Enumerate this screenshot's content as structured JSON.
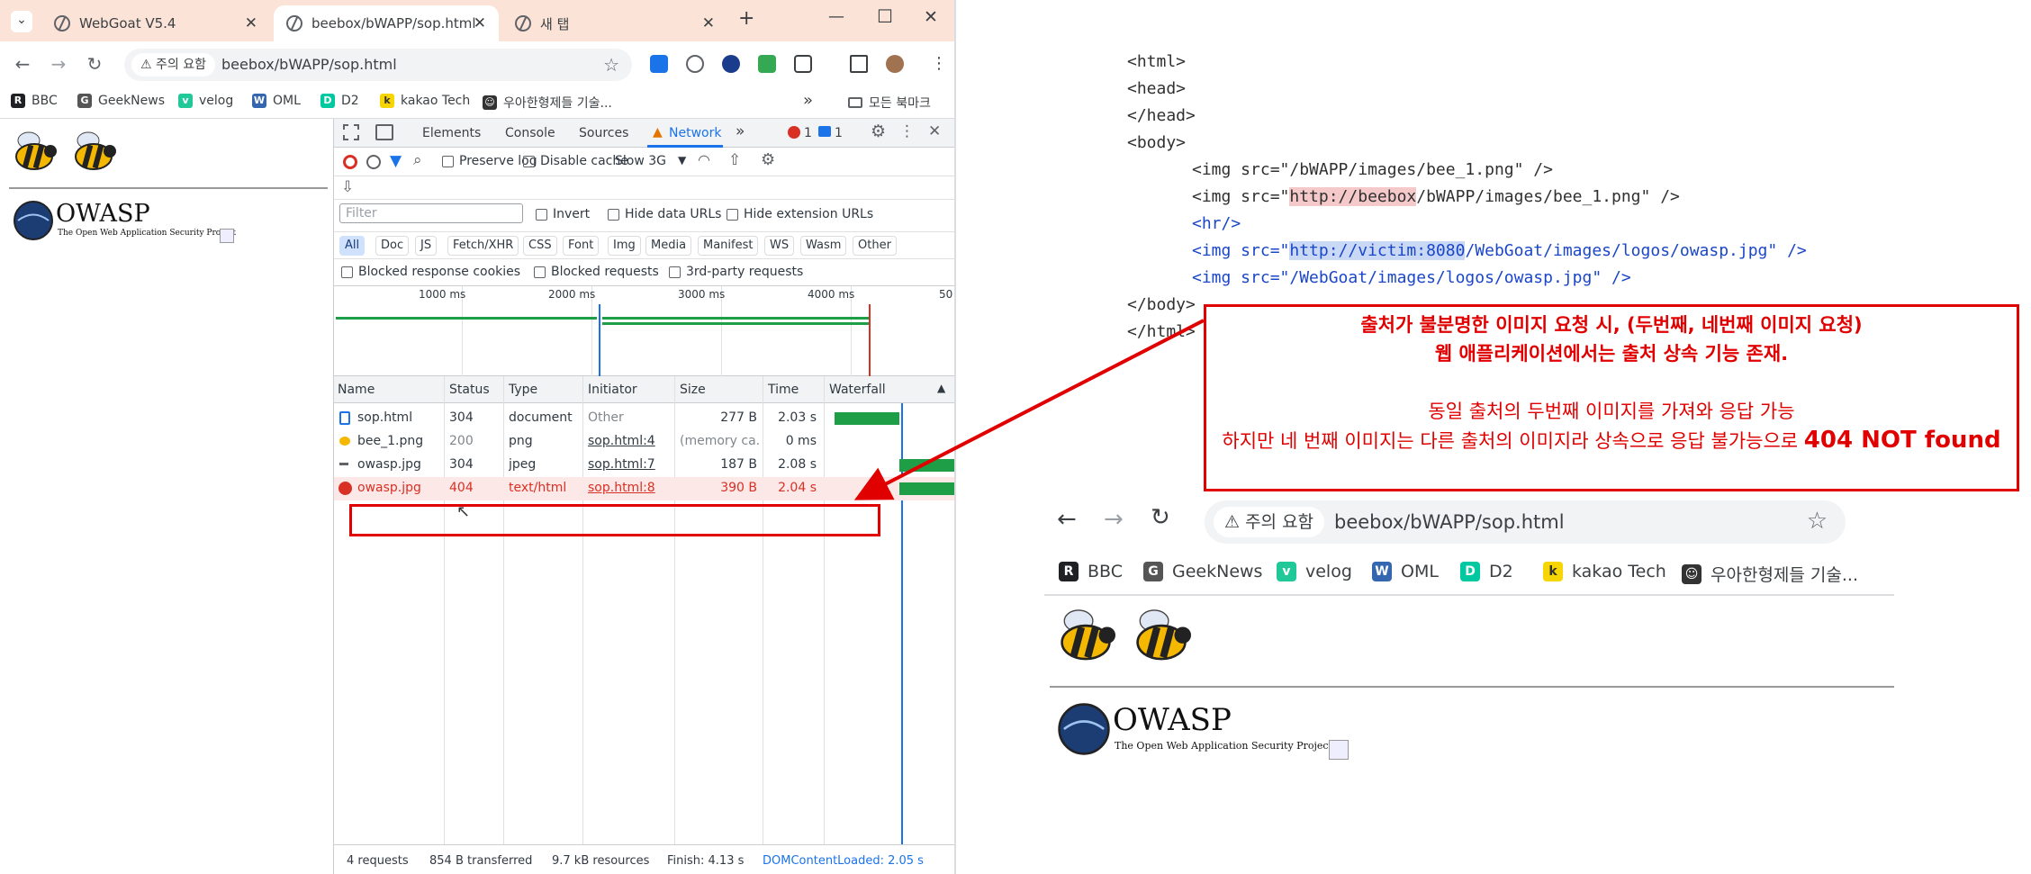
{
  "tabs": [
    {
      "title": "WebGoat V5.4",
      "close": "✕"
    },
    {
      "title": "beebox/bWAPP/sop.html",
      "close": "✕"
    },
    {
      "title": "새 탭",
      "close": "✕"
    }
  ],
  "tabbar": {
    "dropdown": "⌄",
    "new_tab": "+",
    "minimize": "—",
    "maximize": "☐",
    "close": "✕"
  },
  "omnibox": {
    "security": "⚠ 주의 요함",
    "url": "beebox/bWAPP/sop.html"
  },
  "bookmarks": {
    "items": [
      {
        "label": "BBC",
        "icon": "R",
        "color": "#202124"
      },
      {
        "label": "GeekNews",
        "icon": "G",
        "color": "#555555"
      },
      {
        "label": "velog",
        "icon": "v",
        "color": "#20c997"
      },
      {
        "label": "OML",
        "icon": "W",
        "color": "#3467b0"
      },
      {
        "label": "D2",
        "icon": "D",
        "color": "#00c8a0"
      },
      {
        "label": "kakao Tech",
        "icon": "k",
        "color": "#f7d500"
      },
      {
        "label": "우아한형제들 기술...",
        "icon": "☺",
        "color": "#333333"
      }
    ],
    "overflow": "»",
    "all": "모든 북마크"
  },
  "page": {
    "owasp_title": "OWASP",
    "owasp_sub": "The Open Web Application Security Project"
  },
  "devtools": {
    "tabs": [
      "Elements",
      "Console",
      "Sources",
      "Network"
    ],
    "more": "»",
    "errors": "1",
    "messages": "1",
    "preserve_log": "Preserve log",
    "disable_cache": "Disable cache",
    "throttle": "Slow 3G",
    "filter_placeholder": "Filter",
    "invert": "Invert",
    "hide_data_urls": "Hide data URLs",
    "hide_extension_urls": "Hide extension URLs",
    "type_filters": [
      "All",
      "Doc",
      "JS",
      "Fetch/XHR",
      "CSS",
      "Font",
      "Img",
      "Media",
      "Manifest",
      "WS",
      "Wasm",
      "Other"
    ],
    "blocked_cookies": "Blocked response cookies",
    "blocked_requests": "Blocked requests",
    "third_party": "3rd-party requests",
    "timeline_ticks": [
      "1000 ms",
      "2000 ms",
      "3000 ms",
      "4000 ms",
      "50"
    ],
    "columns": [
      "Name",
      "Status",
      "Type",
      "Initiator",
      "Size",
      "Time",
      "Waterfall"
    ],
    "rows": [
      {
        "name": "sop.html",
        "status": "304",
        "type": "document",
        "initiator": "Other",
        "size": "277 B",
        "time": "2.03 s"
      },
      {
        "name": "bee_1.png",
        "status": "200",
        "type": "png",
        "initiator": "sop.html:4",
        "size": "(memory ca...",
        "time": "0 ms"
      },
      {
        "name": "owasp.jpg",
        "status": "304",
        "type": "jpeg",
        "initiator": "sop.html:7",
        "size": "187 B",
        "time": "2.08 s"
      },
      {
        "name": "owasp.jpg",
        "status": "404",
        "type": "text/html",
        "initiator": "sop.html:8",
        "size": "390 B",
        "time": "2.04 s"
      }
    ],
    "status": {
      "requests": "4 requests",
      "transferred": "854 B transferred",
      "resources": "9.7 kB resources",
      "finish": "Finish: 4.13 s",
      "dcl": "DOMContentLoaded: 2.05 s"
    }
  },
  "code": {
    "l1": "<html>",
    "l2": "<head>",
    "l3": "</head>",
    "l4": "<body>",
    "l5": "<img src=\"/bWAPP/images/bee_1.png\" />",
    "l6a": "<img src=\"",
    "l6b": "http://beebox",
    "l6c": "/bWAPP/images/bee_1.png\" />",
    "l7": "<hr/>",
    "l8a": "<img src=\"",
    "l8b": "http://victim:8080",
    "l8c": "/WebGoat/images/logos/owasp.jpg\" />",
    "l9": "<img src=\"/WebGoat/images/logos/owasp.jpg\" />",
    "l10": "</body>",
    "l11": "</html>"
  },
  "annotation": {
    "line1": "출처가 불분명한 이미지 요청 시, (두번째, 네번째 이미지 요청)",
    "line2": "웹 애플리케이션에서는 출처 상속 기능 존재.",
    "line3": "동일 출처의 두번째 이미지를 가져와 응답 가능",
    "line4a": "하지만 네 번째 이미지는  다른 출처의 이미지라 상속으로 응답 불가능으로 ",
    "line4b": "404 NOT found"
  },
  "colors": {
    "accent": "#1a73e8",
    "error": "#d93025",
    "annotation": "#e00000",
    "waterfall": "#1e9e47"
  }
}
